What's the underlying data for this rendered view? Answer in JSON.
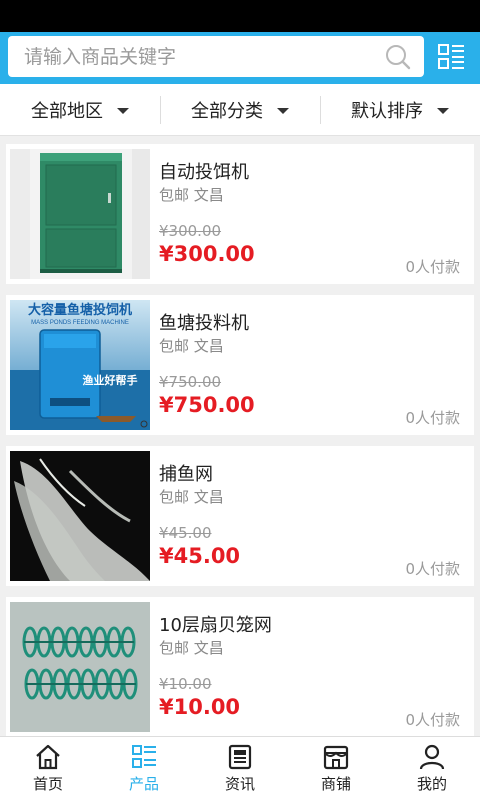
{
  "search": {
    "placeholder": "请输入商品关键字"
  },
  "colors": {
    "accent": "#2ab0ea",
    "price": "#e51c23",
    "icon": "menu-grid-icon"
  },
  "filters": [
    {
      "label": "全部地区"
    },
    {
      "label": "全部分类"
    },
    {
      "label": "默认排序"
    }
  ],
  "products": [
    {
      "name": "自动投饵机",
      "meta": "包邮 文昌",
      "old_price": "¥300.00",
      "price": "¥300.00",
      "sales": "0人付款"
    },
    {
      "name": "鱼塘投料机",
      "meta": "包邮 文昌",
      "old_price": "¥750.00",
      "price": "¥750.00",
      "sales": "0人付款",
      "image_text": {
        "title": "大容量鱼塘投饲机",
        "subtitle": "MASS PONDS FEEDING MACHINE",
        "slogan": "渔业好帮手"
      }
    },
    {
      "name": "捕鱼网",
      "meta": "包邮 文昌",
      "old_price": "¥45.00",
      "price": "¥45.00",
      "sales": "0人付款"
    },
    {
      "name": "10层扇贝笼网",
      "meta": "包邮 文昌",
      "old_price": "¥10.00",
      "price": "¥10.00",
      "sales": "0人付款"
    }
  ],
  "tabs": [
    {
      "label": "首页",
      "icon": "home-icon"
    },
    {
      "label": "产品",
      "icon": "product-list-icon",
      "active": true
    },
    {
      "label": "资讯",
      "icon": "news-icon"
    },
    {
      "label": "商铺",
      "icon": "store-icon"
    },
    {
      "label": "我的",
      "icon": "user-icon"
    }
  ]
}
